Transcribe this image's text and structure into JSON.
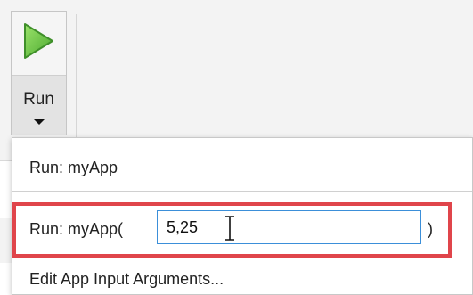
{
  "toolstrip": {
    "run_button": {
      "label": "Run",
      "icon": "play-icon",
      "dropdown_icon": "chevron-down-icon"
    }
  },
  "run_menu": {
    "items": [
      {
        "label": "Run: myApp"
      },
      {
        "label_prefix": "Run: myApp(",
        "input_value": "5,25",
        "label_suffix": ")"
      },
      {
        "label": "Edit App Input Arguments..."
      }
    ]
  },
  "colors": {
    "play_icon": "#6cc24a",
    "highlight_border": "#e0454b",
    "input_border": "#3b8fd9",
    "toolstrip_bg": "#f3f3f3"
  }
}
